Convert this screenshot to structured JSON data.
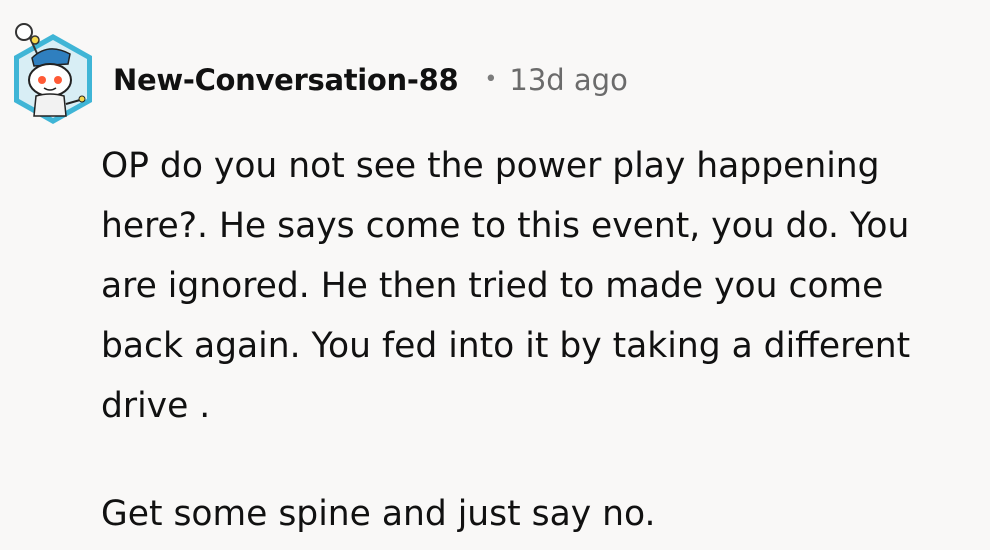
{
  "comment": {
    "avatar_icon": "snoo-avatar-icon",
    "username": "New-Conversation-88",
    "separator": "•",
    "timestamp": "13d ago",
    "paragraphs": [
      "OP do you not see the power play happening\nhere?. He says come to this event, you do. You\nare ignored. He then tried to made you come\nback again. You fed into it by taking a different\ndrive .",
      "Get some spine and just say no."
    ]
  },
  "colors": {
    "background": "#f9f8f7",
    "text": "#111111",
    "meta_text": "#6b6b6b",
    "avatar_hex": "#3fb5d6"
  }
}
